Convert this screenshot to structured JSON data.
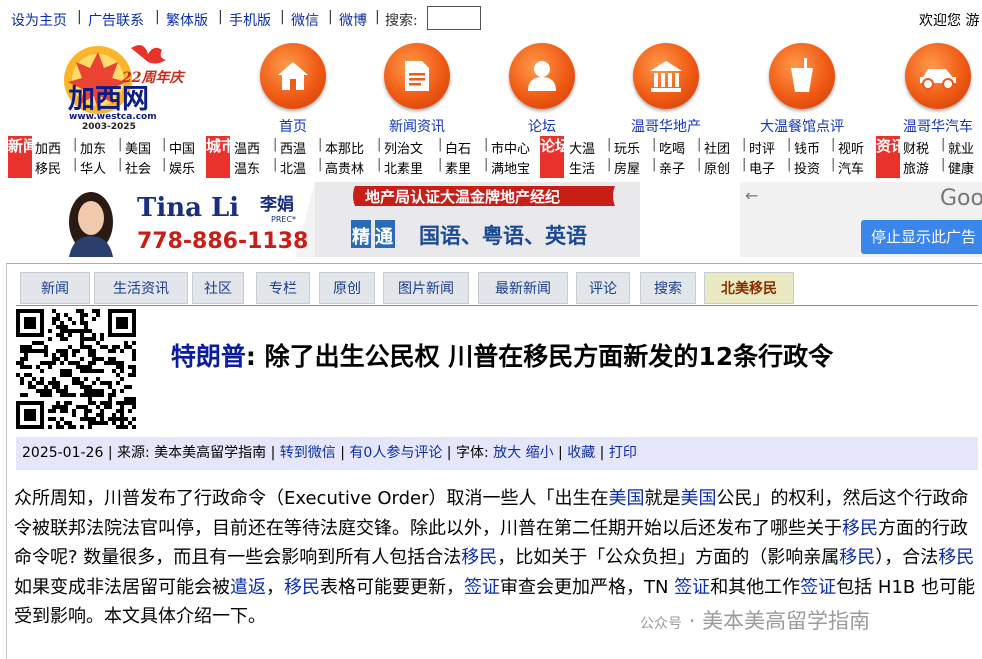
{
  "topbar": {
    "links": [
      "设为主页",
      "广告联系",
      "繁体版",
      "手机版",
      "微信",
      "微博"
    ],
    "search_label": "搜索:",
    "search_value": "",
    "welcome": "欢迎您 游"
  },
  "logo": {
    "anniversary": "22周年庆",
    "name": "加西网",
    "url": "www.westca.com",
    "years": "2003-2025"
  },
  "main_nav": [
    {
      "label": "首页",
      "icon": "home-icon"
    },
    {
      "label": "新闻资讯",
      "icon": "news-icon"
    },
    {
      "label": "论坛",
      "icon": "forum-icon"
    },
    {
      "label": "温哥华地产",
      "icon": "house-icon"
    },
    {
      "label": "大温餐馆点评",
      "icon": "drink-icon"
    },
    {
      "label": "温哥华汽车",
      "icon": "car-icon"
    }
  ],
  "link_groups": [
    {
      "tag": "新闻",
      "rows": [
        [
          "加西",
          "加东",
          "美国",
          "中国"
        ],
        [
          "移民",
          "华人",
          "社会",
          "娱乐"
        ]
      ]
    },
    {
      "tag": "城市",
      "rows": [
        [
          "温西",
          "西温",
          "本那比",
          "列治文",
          "白石",
          "市中心"
        ],
        [
          "温东",
          "北温",
          "高贵林",
          "北素里",
          "素里",
          "满地宝"
        ]
      ]
    },
    {
      "tag": "论坛",
      "rows": [
        [
          "大温",
          "玩乐",
          "吃喝",
          "社团",
          "时评",
          "钱币",
          "视听"
        ],
        [
          "生活",
          "房屋",
          "亲子",
          "原创",
          "电子",
          "投资",
          "汽车"
        ]
      ]
    },
    {
      "tag": "资讯",
      "rows": [
        [
          "财税",
          "就业"
        ],
        [
          "旅游",
          "健康"
        ]
      ]
    }
  ],
  "ad": {
    "name": "Tina Li",
    "cn_name": "李娟",
    "suffix": "PREC*",
    "phone": "778-886-1138",
    "headline": "地产局认证大温金牌地产经纪",
    "lang_prefix": "精通",
    "languages": "国语、粤语、英语"
  },
  "side_ad": {
    "brand": "Goo",
    "stop_label": "停止显示此广告"
  },
  "tabs": [
    {
      "label": "新闻",
      "active": false
    },
    {
      "label": "生活资讯",
      "active": false
    },
    {
      "label": "社区",
      "active": false
    },
    {
      "label": "专栏",
      "active": false
    },
    {
      "label": "原创",
      "active": false
    },
    {
      "label": "图片新闻",
      "active": false
    },
    {
      "label": "最新新闻",
      "active": false
    },
    {
      "label": "评论",
      "active": false
    },
    {
      "label": "搜索",
      "active": false
    },
    {
      "label": "北美移民",
      "active": true
    }
  ],
  "article": {
    "title_keyword": "特朗普",
    "title_rest": ": 除了出生公民权 川普在移民方面新发的12条行政令",
    "meta": {
      "date": "2025-01-26",
      "source_label": "来源:",
      "source": "美本美高留学指南",
      "forward": "转到微信",
      "comments": "有0人参与评论",
      "font_label": "字体:",
      "enlarge": "放大",
      "shrink": "缩小",
      "favorite": "收藏",
      "print": "打印"
    },
    "body": [
      {
        "t": "众所周知，川普发布了行政命令（Executive Order）取消一些人「出生在"
      },
      {
        "t": "美国",
        "link": true
      },
      {
        "t": "就是"
      },
      {
        "t": "美国",
        "link": true
      },
      {
        "t": "公民」的权利，然后这个行政命令被联邦法院法官叫停，目前还在等待法庭交锋。除此以外，川普在第二任期开始以后还发布了哪些关于"
      },
      {
        "t": "移民",
        "link": true
      },
      {
        "t": "方面的行政命令呢? 数量很多，而且有一些会影响到所有人包括合法"
      },
      {
        "t": "移民",
        "link": true
      },
      {
        "t": "，比如关于「公众负担」方面的（影响亲属"
      },
      {
        "t": "移民",
        "link": true
      },
      {
        "t": "），合法"
      },
      {
        "t": "移民",
        "link": true
      },
      {
        "t": "如果变成非法居留可能会被"
      },
      {
        "t": "遣返",
        "link": true
      },
      {
        "t": "，"
      },
      {
        "t": "移民",
        "link": true
      },
      {
        "t": "表格可能要更新，"
      },
      {
        "t": "签证",
        "link": true
      },
      {
        "t": "审查会更加严格，TN "
      },
      {
        "t": "签证",
        "link": true
      },
      {
        "t": "和其他工作"
      },
      {
        "t": "签证",
        "link": true
      },
      {
        "t": "包括 H1B 也可能受到影响。本文具体介绍一下。"
      }
    ]
  },
  "watermark": {
    "account": "公众号",
    "separator": "·",
    "name": "美本美高留学指南"
  },
  "colors": {
    "link_blue": "#0a2ea8",
    "nav_orange": "#f05a14",
    "tag_red": "#e8322b",
    "meta_bg": "#e6e6fb",
    "active_tab_bg": "#e9e9c2"
  }
}
